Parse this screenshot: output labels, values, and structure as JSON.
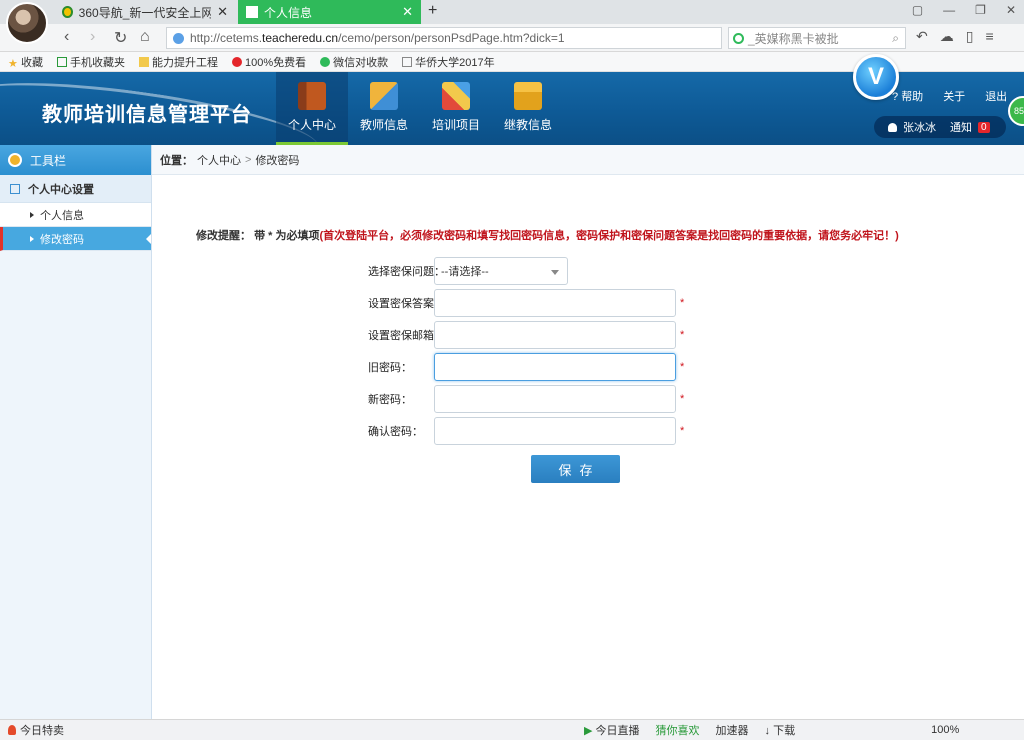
{
  "browser": {
    "tabs": [
      {
        "title": "360导航_新一代安全上网导航",
        "active": false
      },
      {
        "title": "个人信息",
        "active": true
      }
    ],
    "new_tab": "+",
    "url_prefix": "http://cetems.",
    "url_domain": "teacheredu.cn",
    "url_path": "/cemo/person/personPsdPage.htm?dick=1",
    "search_placeholder": "_英媒称黑卡被批",
    "bookmarks": [
      "收藏",
      "手机收藏夹",
      "能力提升工程",
      "100%免费看",
      "微信对收款",
      "华侨大学2017年"
    ]
  },
  "header": {
    "app_title": "教师培训信息管理平台",
    "nav": [
      {
        "label": "个人中心",
        "active": true
      },
      {
        "label": "教师信息",
        "active": false
      },
      {
        "label": "培训项目",
        "active": false
      },
      {
        "label": "继教信息",
        "active": false
      }
    ],
    "help": "帮助",
    "about": "关于",
    "logout": "退出",
    "username": "张冰冰",
    "notify": "通知",
    "notify_count": "0",
    "v_logo": "V",
    "ball_text": "85"
  },
  "sidebar": {
    "title": "工具栏",
    "group": "个人中心设置",
    "items": [
      {
        "label": "个人信息",
        "active": false
      },
      {
        "label": "修改密码",
        "active": true
      }
    ]
  },
  "breadcrumb": {
    "prefix": "位置：",
    "level1": "个人中心",
    "sep": ">",
    "level2": "修改密码"
  },
  "form": {
    "notice_label": "修改提醒：",
    "notice_mid": "带 * 为必填项",
    "notice_red": "(首次登陆平台，必须修改密码和填写找回密码信息，密码保护和密保问题答案是找回密码的重要依据，请您务必牢记！)",
    "question_label": "选择密保问题：",
    "question_value": "--请选择--",
    "answer_label": "设置密保答案：",
    "email_label": "设置密保邮箱：",
    "old_label": "旧密码：",
    "new_label": "新密码：",
    "confirm_label": "确认密码：",
    "required_mark": "*",
    "save_label": "保存"
  },
  "statusbar": {
    "left": "今日特卖",
    "items": [
      "今日直播",
      "猜你喜欢",
      "加速器",
      "下载",
      "100%"
    ]
  }
}
